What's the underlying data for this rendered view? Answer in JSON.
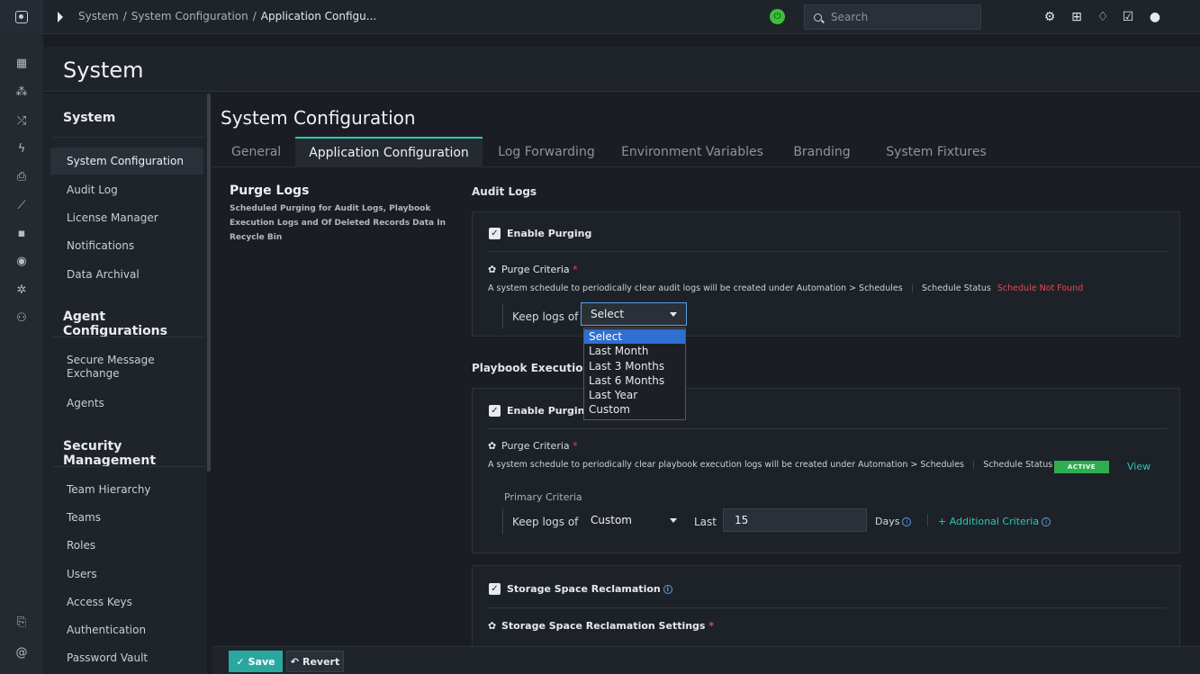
{
  "topbar": {
    "breadcrumb": [
      "System",
      "System Configuration",
      "Application Configu..."
    ],
    "search_placeholder": "Search"
  },
  "rail_icons": [
    "dashboard-icon",
    "incidents-icon",
    "shuffle-icon",
    "bolt-icon",
    "briefcase-icon",
    "chart-icon",
    "widgets-icon",
    "radar-icon",
    "settings-wheel-icon",
    "users-icon",
    "clipboard-icon",
    "at-icon"
  ],
  "header": {
    "title": "System"
  },
  "sidebar": {
    "group_system": "System",
    "system_items": [
      "System Configuration",
      "Audit Log",
      "License Manager",
      "Notifications",
      "Data Archival"
    ],
    "group_agents": "Agent Configurations",
    "agent_items": [
      "Secure Message Exchange",
      "Agents"
    ],
    "group_security": "Security Management",
    "security_items": [
      "Team Hierarchy",
      "Teams",
      "Roles",
      "Users",
      "Access Keys",
      "Authentication",
      "Password Vault"
    ]
  },
  "main": {
    "title": "System Configuration",
    "tabs": [
      "General",
      "Application Configuration",
      "Log Forwarding",
      "Environment Variables",
      "Branding",
      "System Fixtures"
    ],
    "active_tab": "Application Configuration",
    "section_title": "Purge Logs",
    "section_desc": "Scheduled Purging for Audit Logs, Playbook Execution Logs and Of Deleted Records Data In Recycle Bin"
  },
  "audit": {
    "heading": "Audit Logs",
    "enable_label": "Enable Purging",
    "criteria_label": "Purge Criteria",
    "criteria_desc": "A system schedule to periodically clear audit logs will be created under Automation > Schedules",
    "schedule_status_label": "Schedule Status",
    "schedule_status_value": "Schedule Not Found",
    "keep_label": "Keep logs of",
    "select_value": "Select",
    "dropdown_options": [
      "Select",
      "Last Month",
      "Last 3 Months",
      "Last 6 Months",
      "Last Year",
      "Custom"
    ],
    "dropdown_selected": "Select"
  },
  "playbook": {
    "heading": "Playbook Execution",
    "enable_label": "Enable Purging",
    "criteria_label": "Purge Criteria",
    "criteria_desc": "A system schedule to periodically clear playbook execution logs will be created under Automation > Schedules",
    "schedule_status_label": "Schedule Status",
    "schedule_status_value": "ACTIVE",
    "view_link": "View",
    "primary_criteria": "Primary Criteria",
    "keep_label": "Keep logs of",
    "select_value": "Custom",
    "last_label": "Last",
    "days_value": "15",
    "days_label": "Days",
    "additional_criteria": "+ Additional Criteria"
  },
  "storage": {
    "reclamation_label": "Storage Space Reclamation",
    "settings_label": "Storage Space Reclamation Settings"
  },
  "footer": {
    "save_label": "Save",
    "revert_label": "Revert"
  },
  "colors": {
    "accent": "#2ec4b6",
    "active_badge": "#2fae4f",
    "error": "#e5484d",
    "dropdown_highlight": "#2f6fd0"
  }
}
